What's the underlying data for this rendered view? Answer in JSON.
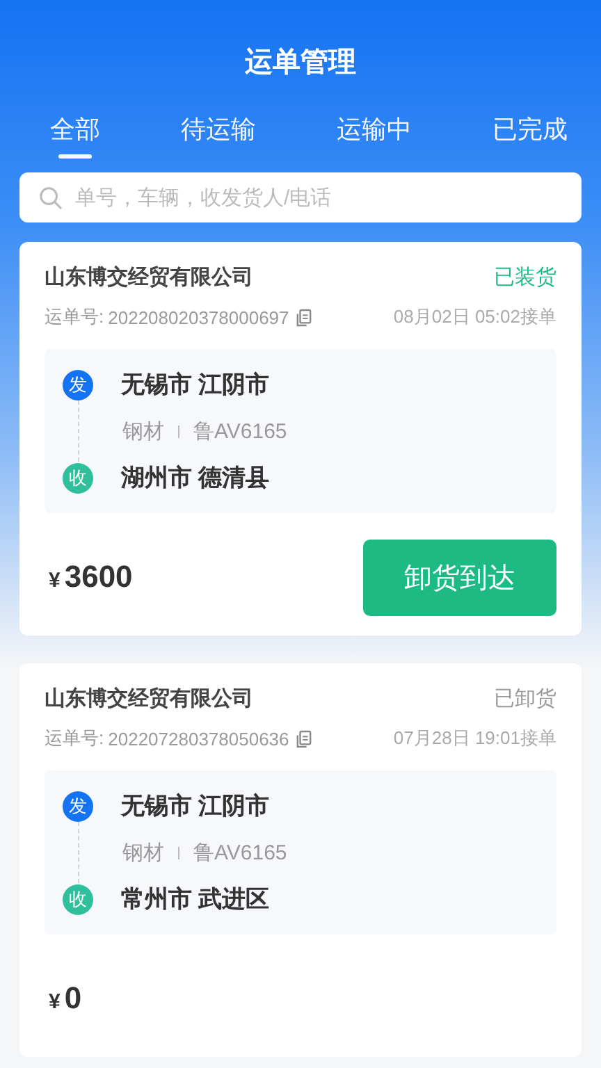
{
  "title": "运单管理",
  "tabs": [
    {
      "label": "全部",
      "selected": true
    },
    {
      "label": "待运输",
      "selected": false
    },
    {
      "label": "运输中",
      "selected": false
    },
    {
      "label": "已完成",
      "selected": false
    }
  ],
  "search": {
    "placeholder": "单号，车辆，收发货人/电话"
  },
  "orders": [
    {
      "company": "山东博交经贸有限公司",
      "status": "已装货",
      "color": "#1dba84",
      "waybill_label": "运单号:",
      "waybill_no": "202208020378000697",
      "time": "08月02日 05:02接单",
      "from_badge": "发",
      "from": "无锡市 江阴市",
      "goods": "钢材",
      "plate": "鲁AV6165",
      "to_badge": "收",
      "to": "湖州市 德清县",
      "currency": "¥",
      "amount": "3600",
      "action": "卸货到达"
    },
    {
      "company": "山东博交经贸有限公司",
      "status": "已卸货",
      "color": "#999999",
      "waybill_label": "运单号:",
      "waybill_no": "202207280378050636",
      "time": "07月28日 19:01接单",
      "from_badge": "发",
      "from": "无锡市 江阴市",
      "goods": "钢材",
      "plate": "鲁AV6165",
      "to_badge": "收",
      "to": "常州市 武进区",
      "currency": "¥",
      "amount": "0"
    }
  ]
}
